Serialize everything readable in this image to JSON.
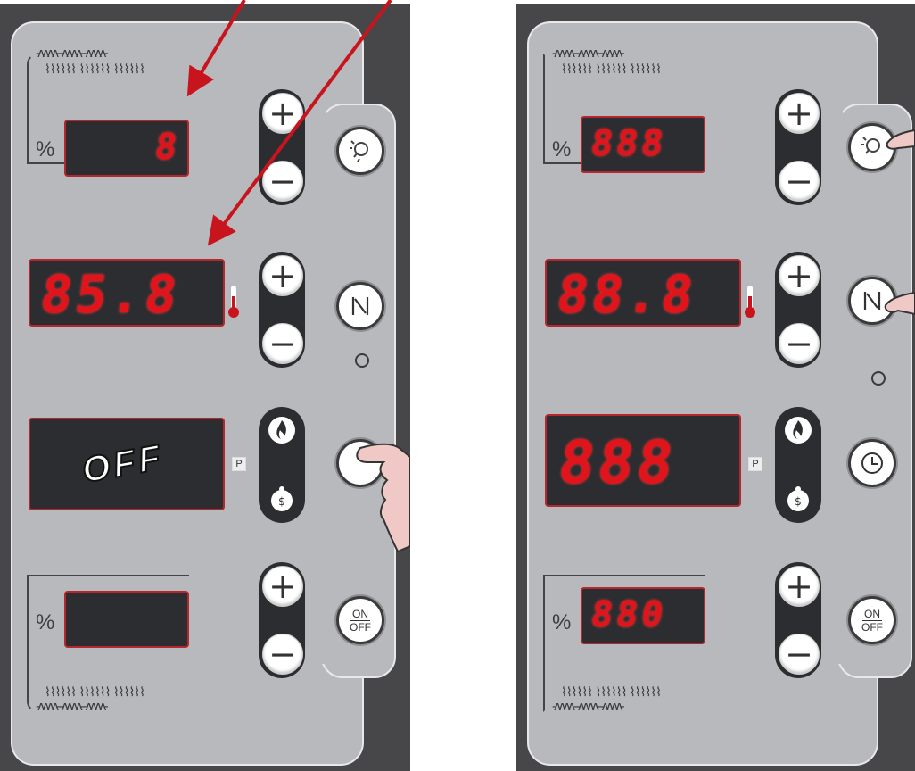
{
  "left": {
    "top_display": {
      "percent_label": "%",
      "value": "8"
    },
    "temp_display": {
      "value": "85.8"
    },
    "mode_display": {
      "value": "OFF"
    },
    "bottom_display": {
      "percent_label": "%",
      "value": ""
    },
    "buttons": {
      "plus": "+",
      "minus": "−",
      "on": "ON",
      "off": "OFF",
      "program_label": "P"
    }
  },
  "right": {
    "top_display": {
      "percent_label": "%",
      "value": "888"
    },
    "temp_display": {
      "value": "88.8"
    },
    "mode_display": {
      "value": "888"
    },
    "bottom_display": {
      "percent_label": "%",
      "value": "880"
    },
    "buttons": {
      "plus": "+",
      "minus": "−",
      "on": "ON",
      "off": "OFF",
      "program_label": "P"
    }
  },
  "colors": {
    "display_red": "#e1141c",
    "arrow_red": "#c8141c"
  }
}
